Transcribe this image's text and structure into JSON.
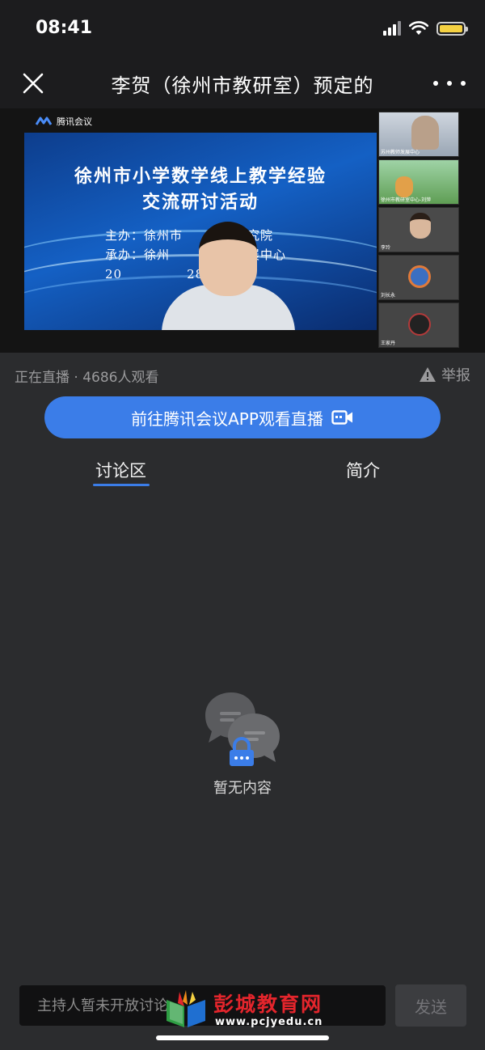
{
  "status_bar": {
    "time": "08:41"
  },
  "nav": {
    "title": "李贺（徐州市教研室）预定的"
  },
  "video": {
    "brand": "腾讯会议",
    "slide": {
      "title_line1": "徐州市小学数学线上教学经验",
      "title_line2": "交流研讨活动",
      "organizer": "主办：徐州市　　科学研究院",
      "co_organizer": "承办：徐州　　　教师发展中心",
      "date": "20　　　　　28日"
    },
    "thumbnails": [
      {
        "label": "苏州教师发展中心"
      },
      {
        "label": "徐州市教研室中心-刘萍"
      },
      {
        "label": "李玲"
      },
      {
        "label": "刘长永"
      },
      {
        "label": "王家丹"
      }
    ]
  },
  "live": {
    "status": "正在直播 · 4686人观看",
    "report_label": "举报"
  },
  "cta": {
    "label": "前往腾讯会议APP观看直播"
  },
  "tabs": [
    {
      "label": "讨论区"
    },
    {
      "label": "简介"
    }
  ],
  "empty_state": {
    "text": "暂无内容"
  },
  "comment": {
    "placeholder": "主持人暂未开放讨论",
    "send_label": "发送"
  },
  "watermark": {
    "title": "彭城教育网",
    "url": "www.pcjyedu.cn"
  },
  "colors": {
    "accent": "#3b7de8",
    "background": "#2b2c2e",
    "watermark_red": "#e4252c"
  }
}
